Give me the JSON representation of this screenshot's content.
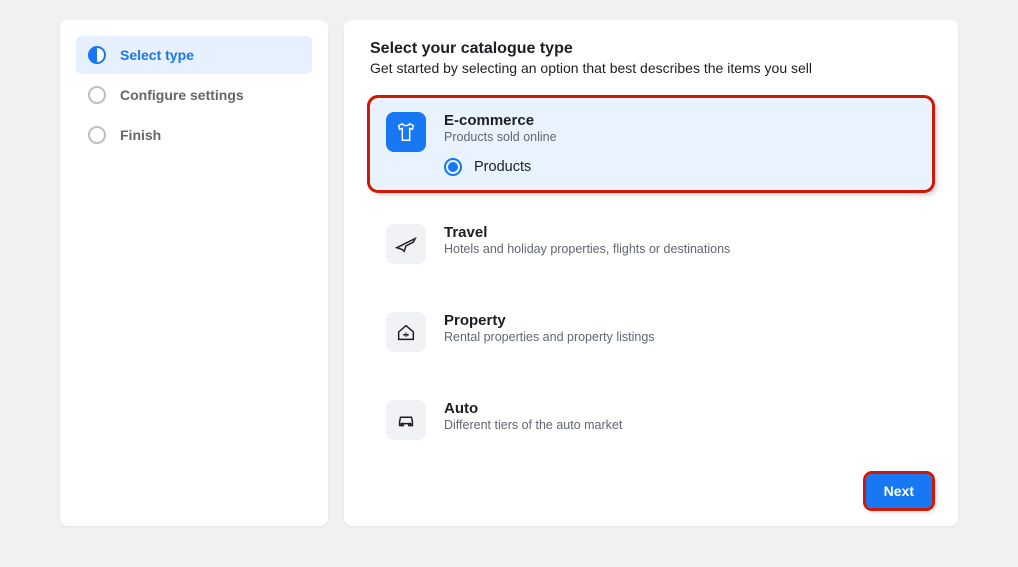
{
  "sidebar": {
    "steps": [
      {
        "label": "Select type",
        "active": true
      },
      {
        "label": "Configure settings",
        "active": false
      },
      {
        "label": "Finish",
        "active": false
      }
    ]
  },
  "main": {
    "title": "Select your catalogue type",
    "subtitle": "Get started by selecting an option that best describes the items you sell",
    "options": [
      {
        "title": "E-commerce",
        "desc": "Products sold online",
        "selected": true,
        "sublabel": "Products"
      },
      {
        "title": "Travel",
        "desc": "Hotels and holiday properties, flights or destinations"
      },
      {
        "title": "Property",
        "desc": "Rental properties and property listings"
      },
      {
        "title": "Auto",
        "desc": "Different tiers of the auto market"
      }
    ],
    "next_label": "Next"
  }
}
